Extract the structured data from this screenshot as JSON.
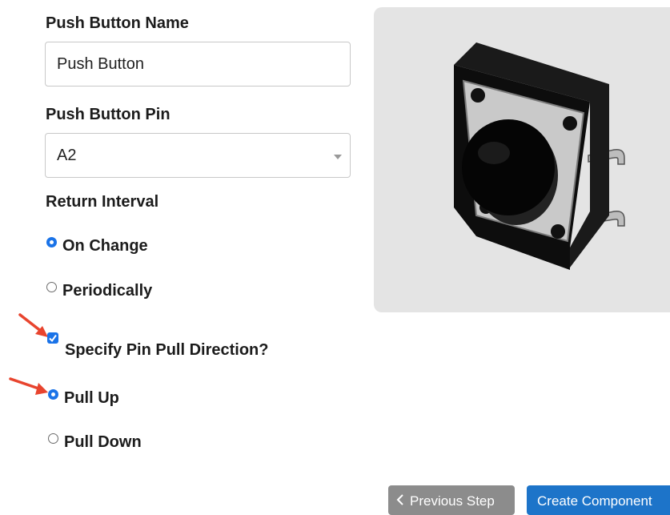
{
  "form": {
    "name_label": "Push Button Name",
    "name_value": "Push Button",
    "pin_label": "Push Button Pin",
    "pin_value": "A2",
    "interval_label": "Return Interval",
    "interval_options": [
      {
        "label": "On Change",
        "selected": true
      },
      {
        "label": "Periodically",
        "selected": false
      }
    ],
    "pull_checkbox_label": "Specify Pin Pull Direction?",
    "pull_checkbox_checked": true,
    "pull_options": [
      {
        "label": "Pull Up",
        "selected": true
      },
      {
        "label": "Pull Down",
        "selected": false
      }
    ]
  },
  "buttons": {
    "previous_label": "Previous Step",
    "create_label": "Create Component"
  },
  "colors": {
    "accent": "#1a73e8",
    "create_button": "#1d74c9",
    "previous_button": "#8c8c8c",
    "annotation_arrow": "#e8442e",
    "image_panel_bg": "#e4e4e4"
  },
  "icons": {
    "dropdown": "caret-down-icon",
    "previous": "chevron-left-icon",
    "annotation": "red-arrow-icon"
  }
}
